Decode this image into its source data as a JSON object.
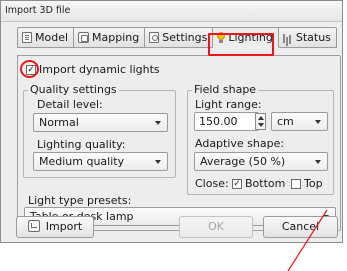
{
  "window": {
    "title": "Import 3D file"
  },
  "tabs": [
    {
      "label": "Model",
      "icon": "model-icon"
    },
    {
      "label": "Mapping",
      "icon": "mapping-icon"
    },
    {
      "label": "Settings",
      "icon": "settings-icon"
    },
    {
      "label": "Lighting",
      "icon": "lightbulb-icon",
      "active": true
    },
    {
      "label": "Status",
      "icon": "status-icon"
    }
  ],
  "import_dynamic_lights": {
    "label": "Import dynamic lights",
    "checked": true
  },
  "quality_settings": {
    "title": "Quality settings",
    "detail_label": "Detail level:",
    "detail_value": "Normal",
    "quality_label": "Lighting quality:",
    "quality_value": "Medium quality"
  },
  "field_shape": {
    "title": "Field shape",
    "range_label": "Light range:",
    "range_value": "150.00",
    "unit_value": "cm",
    "adaptive_label": "Adaptive shape:",
    "adaptive_value": "Average (50 %)",
    "close_label": "Close:",
    "bottom_label": "Bottom",
    "bottom_checked": true,
    "top_label": "Top",
    "top_checked": false
  },
  "presets": {
    "label": "Light type presets:",
    "value": "Table or desk lamp"
  },
  "buttons": {
    "import": "Import",
    "ok": "OK",
    "cancel": "Cancel"
  },
  "colors": {
    "annotation_red": "#e8171c",
    "window_bg": "#ededed"
  }
}
